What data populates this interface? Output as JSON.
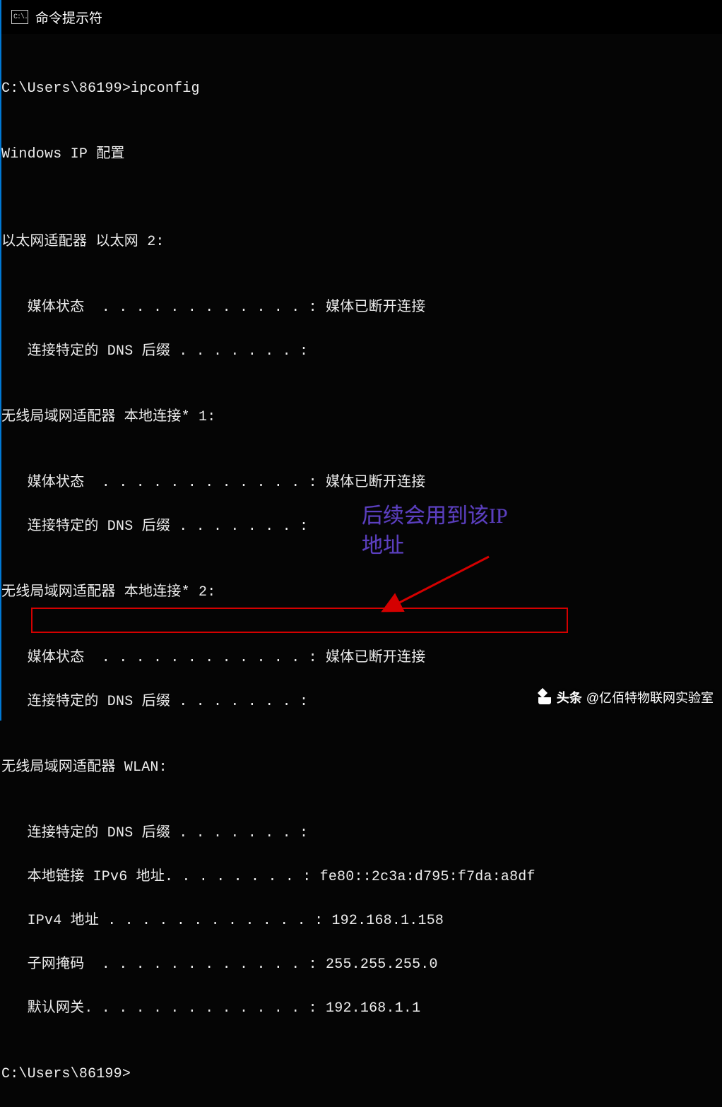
{
  "titlebar": {
    "icon_text": "C:\\.",
    "title": "命令提示符"
  },
  "terminal": {
    "prompt1": "C:\\Users\\86199>ipconfig",
    "blank": "",
    "header": "Windows IP 配置",
    "adapter1_title": "以太网适配器 以太网 2:",
    "adapter1_media": "   媒体状态  . . . . . . . . . . . . : 媒体已断开连接",
    "adapter1_dns": "   连接特定的 DNS 后缀 . . . . . . . :",
    "adapter2_title": "无线局域网适配器 本地连接* 1:",
    "adapter2_media": "   媒体状态  . . . . . . . . . . . . : 媒体已断开连接",
    "adapter2_dns": "   连接特定的 DNS 后缀 . . . . . . . :",
    "adapter3_title": "无线局域网适配器 本地连接* 2:",
    "adapter3_media": "   媒体状态  . . . . . . . . . . . . : 媒体已断开连接",
    "adapter3_dns": "   连接特定的 DNS 后缀 . . . . . . . :",
    "adapter4_title": "无线局域网适配器 WLAN:",
    "adapter4_dns": "   连接特定的 DNS 后缀 . . . . . . . :",
    "adapter4_ipv6": "   本地链接 IPv6 地址. . . . . . . . : fe80::2c3a:d795:f7da:a8df",
    "adapter4_ipv4": "   IPv4 地址 . . . . . . . . . . . . : 192.168.1.158",
    "adapter4_mask": "   子网掩码  . . . . . . . . . . . . : 255.255.255.0",
    "adapter4_gw": "   默认网关. . . . . . . . . . . . . : 192.168.1.1",
    "prompt2": "C:\\Users\\86199>"
  },
  "annotation": {
    "text": "后续会用到该IP\n地址"
  },
  "watermark": {
    "prefix": "头条",
    "text": "@亿佰特物联网实验室"
  }
}
